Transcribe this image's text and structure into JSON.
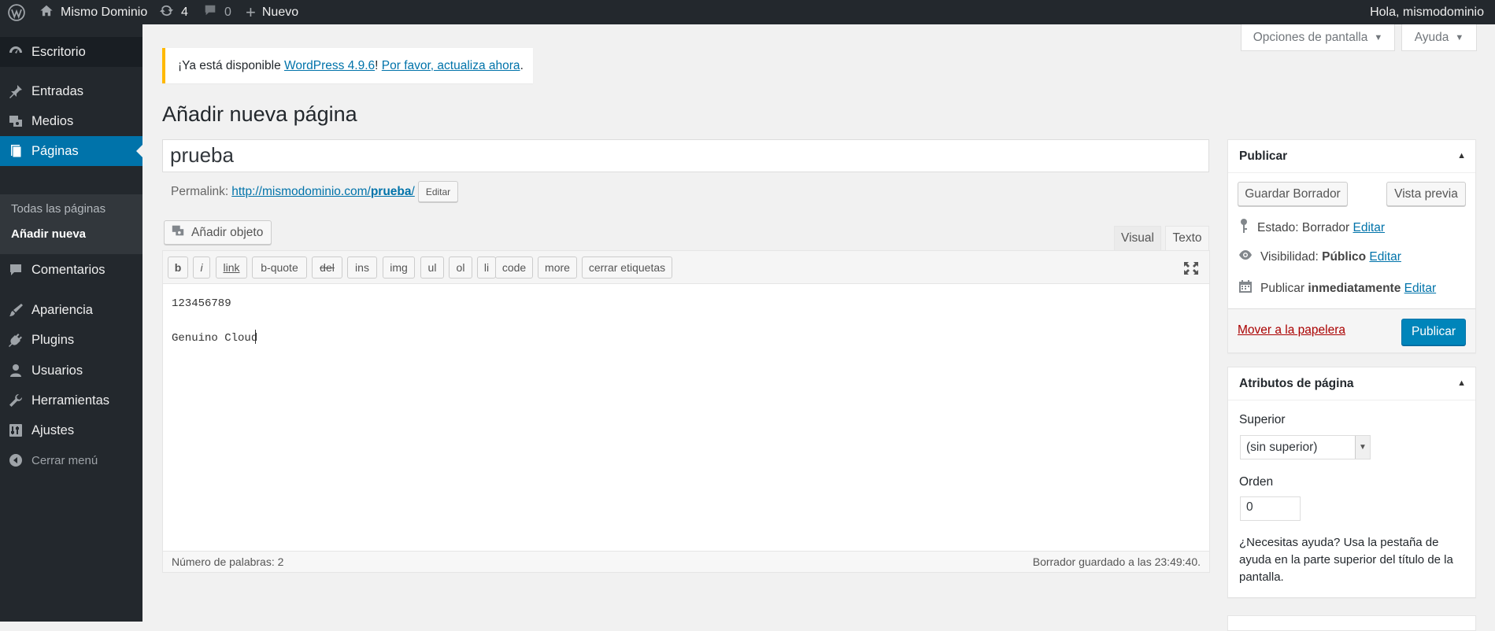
{
  "adminbar": {
    "site_name": "Mismo Dominio",
    "updates_count": "4",
    "comments_count": "0",
    "new_label": "Nuevo",
    "greeting": "Hola, mismodominio"
  },
  "sidebar": {
    "items": [
      {
        "label": "Escritorio",
        "icon": "dashboard-icon"
      },
      {
        "label": "Entradas",
        "icon": "pin-icon"
      },
      {
        "label": "Medios",
        "icon": "media-icon"
      },
      {
        "label": "Páginas",
        "icon": "page-icon"
      },
      {
        "label": "Comentarios",
        "icon": "comment-icon"
      },
      {
        "label": "Apariencia",
        "icon": "brush-icon"
      },
      {
        "label": "Plugins",
        "icon": "plugin-icon"
      },
      {
        "label": "Usuarios",
        "icon": "user-icon"
      },
      {
        "label": "Herramientas",
        "icon": "wrench-icon"
      },
      {
        "label": "Ajustes",
        "icon": "settings-icon"
      }
    ],
    "submenu": [
      "Todas las páginas",
      "Añadir nueva"
    ],
    "collapse_label": "Cerrar menú"
  },
  "screen_meta": {
    "screen_options": "Opciones de pantalla",
    "help": "Ayuda"
  },
  "notice": {
    "prefix": "¡Ya está disponible ",
    "version_link": "WordPress 4.9.6",
    "middle": "! ",
    "update_link": "Por favor, actualiza ahora",
    "suffix": "."
  },
  "page_title": "Añadir nueva página",
  "post_title": "prueba",
  "permalink": {
    "label": "Permalink:",
    "url_base": "http://mismodominio.com/",
    "slug": "prueba",
    "url_end": "/",
    "edit_button": "Editar"
  },
  "editor": {
    "add_media": "Añadir objeto",
    "tab_visual": "Visual",
    "tab_text": "Texto",
    "quicktags": [
      "b",
      "i",
      "link",
      "b-quote",
      "del",
      "ins",
      "img",
      "ul",
      "ol",
      "li",
      "code",
      "more",
      "cerrar etiquetas"
    ],
    "content": "123456789\n\nGenuino Cloud",
    "word_count": "Número de palabras: 2",
    "autosave": "Borrador guardado a las 23:49:40."
  },
  "publish_box": {
    "title": "Publicar",
    "save_draft": "Guardar Borrador",
    "preview": "Vista previa",
    "status_label": "Estado: ",
    "status_value": "Borrador",
    "visibility_label": "Visibilidad: ",
    "visibility_value": "Público",
    "publish_label": "Publicar ",
    "publish_value": "inmediatamente",
    "edit_link": "Editar",
    "trash_link": "Mover a la papelera",
    "publish_button": "Publicar"
  },
  "attributes_box": {
    "title": "Atributos de página",
    "parent_label": "Superior",
    "parent_value": "(sin superior)",
    "order_label": "Orden",
    "order_value": "0",
    "help_text": "¿Necesitas ayuda? Usa la pestaña de ayuda en la parte superior del título de la pantalla."
  },
  "colors": {
    "adminbar_bg": "#23282d",
    "accent": "#0073aa",
    "primary_button": "#0085ba",
    "notice_border": "#ffb900",
    "trash": "#a00"
  }
}
